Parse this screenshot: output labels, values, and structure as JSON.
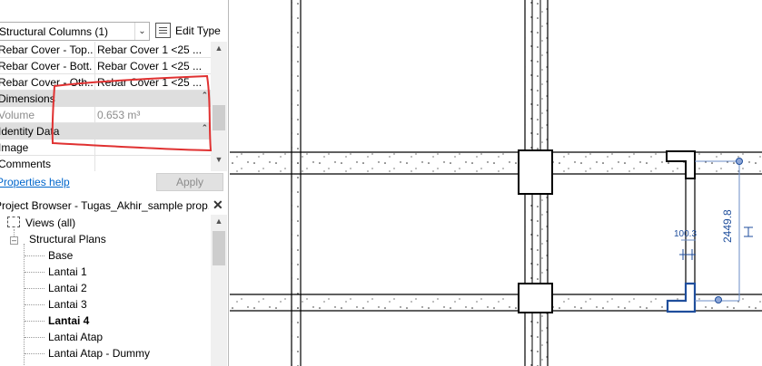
{
  "properties": {
    "type_selector": "Structural Columns (1)",
    "edit_type_label": "Edit Type",
    "rows": [
      {
        "key": "Rebar Cover - Top...",
        "value": "Rebar Cover 1 <25 ..."
      },
      {
        "key": "Rebar Cover - Bott...",
        "value": "Rebar Cover 1 <25 ..."
      },
      {
        "key": "Rebar Cover - Oth...",
        "value": "Rebar Cover 1 <25 ..."
      }
    ],
    "group_dimensions": "Dimensions",
    "volume_key": "Volume",
    "volume_value": "0.653 m³",
    "group_identity": "Identity Data",
    "image_key": "Image",
    "comments_key": "Comments",
    "help_link": "Properties help",
    "apply_label": "Apply"
  },
  "project_browser": {
    "title": "Project Browser - Tugas_Akhir_sample prop...",
    "views_root": "Views (all)",
    "structural_plans": "Structural Plans",
    "plans": [
      "Base",
      "Lantai 1",
      "Lantai 2",
      "Lantai 3",
      "Lantai 4",
      "Lantai Atap",
      "Lantai Atap - Dummy"
    ],
    "active_plan": "Lantai 4"
  },
  "canvas": {
    "dim_small": "100.3",
    "dim_large": "2449.8",
    "selection_color": "#1f4e9c",
    "markup_color": "#e03131"
  }
}
